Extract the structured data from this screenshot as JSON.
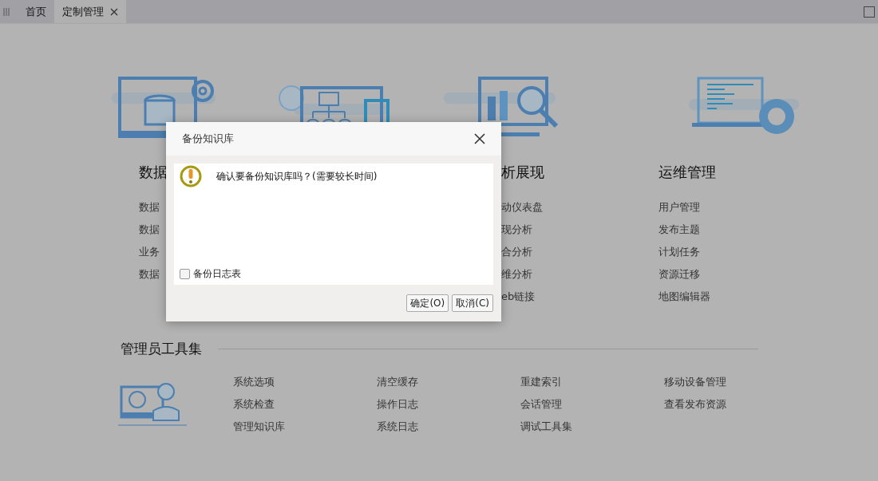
{
  "tabs": [
    {
      "label": "首页",
      "selected": false,
      "closable": false
    },
    {
      "label": "定制管理",
      "selected": true,
      "closable": true
    }
  ],
  "modules": [
    {
      "kind": "database",
      "title": "数据",
      "items": [
        "数据",
        "数据",
        "业务",
        "数据"
      ]
    },
    {
      "kind": "network"
    },
    {
      "kind": "chart",
      "title": "析展现",
      "items": [
        "动仪表盘",
        "现分析",
        "合分析",
        "维分析",
        "eb链接"
      ]
    },
    {
      "kind": "maintenance",
      "title": "运维管理",
      "items": [
        "用户管理",
        "发布主题",
        "计划任务",
        "资源迁移",
        "地图编辑器"
      ]
    }
  ],
  "admin": {
    "title": "管理员工具集",
    "columns": [
      [
        "系统选项",
        "系统检查",
        "管理知识库"
      ],
      [
        "清空缓存",
        "操作日志",
        "系统日志"
      ],
      [
        "重建索引",
        "会话管理",
        "调试工具集"
      ],
      [
        "移动设备管理",
        "查看发布资源"
      ]
    ]
  },
  "dialog": {
    "title": "备份知识库",
    "message": "确认要备份知识库吗？(需要较长时间)",
    "checkbox": {
      "label": "备份日志表",
      "checked": false
    },
    "buttons": [
      "确定(O)",
      "取消(C)"
    ]
  }
}
